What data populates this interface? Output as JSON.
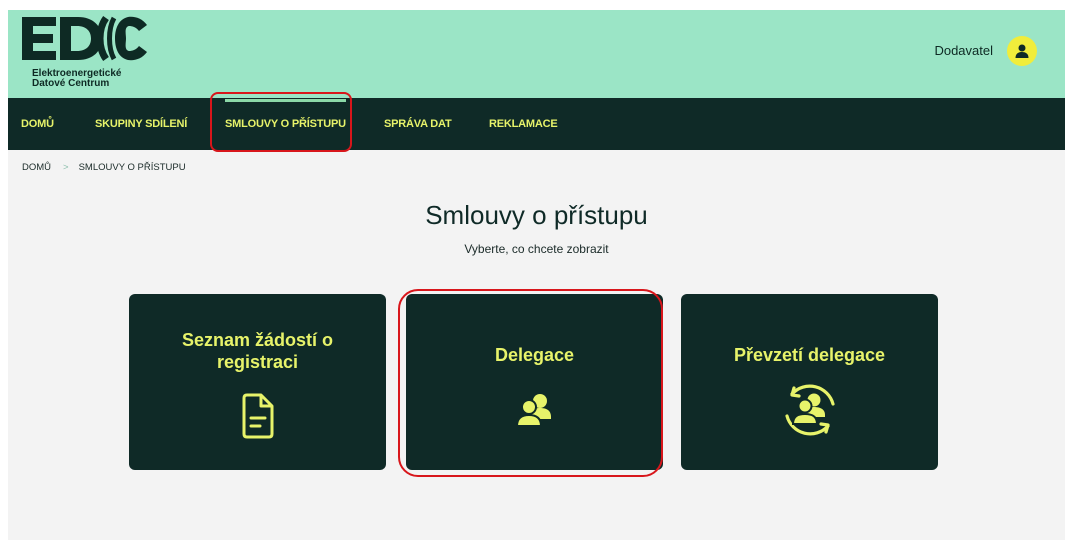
{
  "header": {
    "logo_text": "EDC",
    "logo_subtitle_line1": "Elektroenergetické",
    "logo_subtitle_line2": "Datové Centrum",
    "user_role": "Dodavatel",
    "user_icon": "user-icon"
  },
  "nav": {
    "items": [
      {
        "label": "DOMŮ"
      },
      {
        "label": "SKUPINY SDÍLENÍ"
      },
      {
        "label": "SMLOUVY O PŘÍSTUPU",
        "active": true
      },
      {
        "label": "SPRÁVA DAT"
      },
      {
        "label": "REKLAMACE"
      }
    ]
  },
  "breadcrumb": {
    "home": "DOMŮ",
    "current": "SMLOUVY O PŘÍSTUPU"
  },
  "main": {
    "title": "Smlouvy o přístupu",
    "subtitle": "Vyberte, co chcete zobrazit"
  },
  "cards": [
    {
      "title_line1": "Seznam žádostí o",
      "title_line2": "registraci",
      "icon": "document-icon"
    },
    {
      "title_line1": "Delegace",
      "icon": "users-icon"
    },
    {
      "title_line1": "Převzetí delegace",
      "icon": "users-transfer-icon"
    }
  ],
  "colors": {
    "header_bg": "#9be5c6",
    "nav_bg": "#0f2a27",
    "accent": "#e7f36a",
    "highlight": "#d8161b"
  }
}
